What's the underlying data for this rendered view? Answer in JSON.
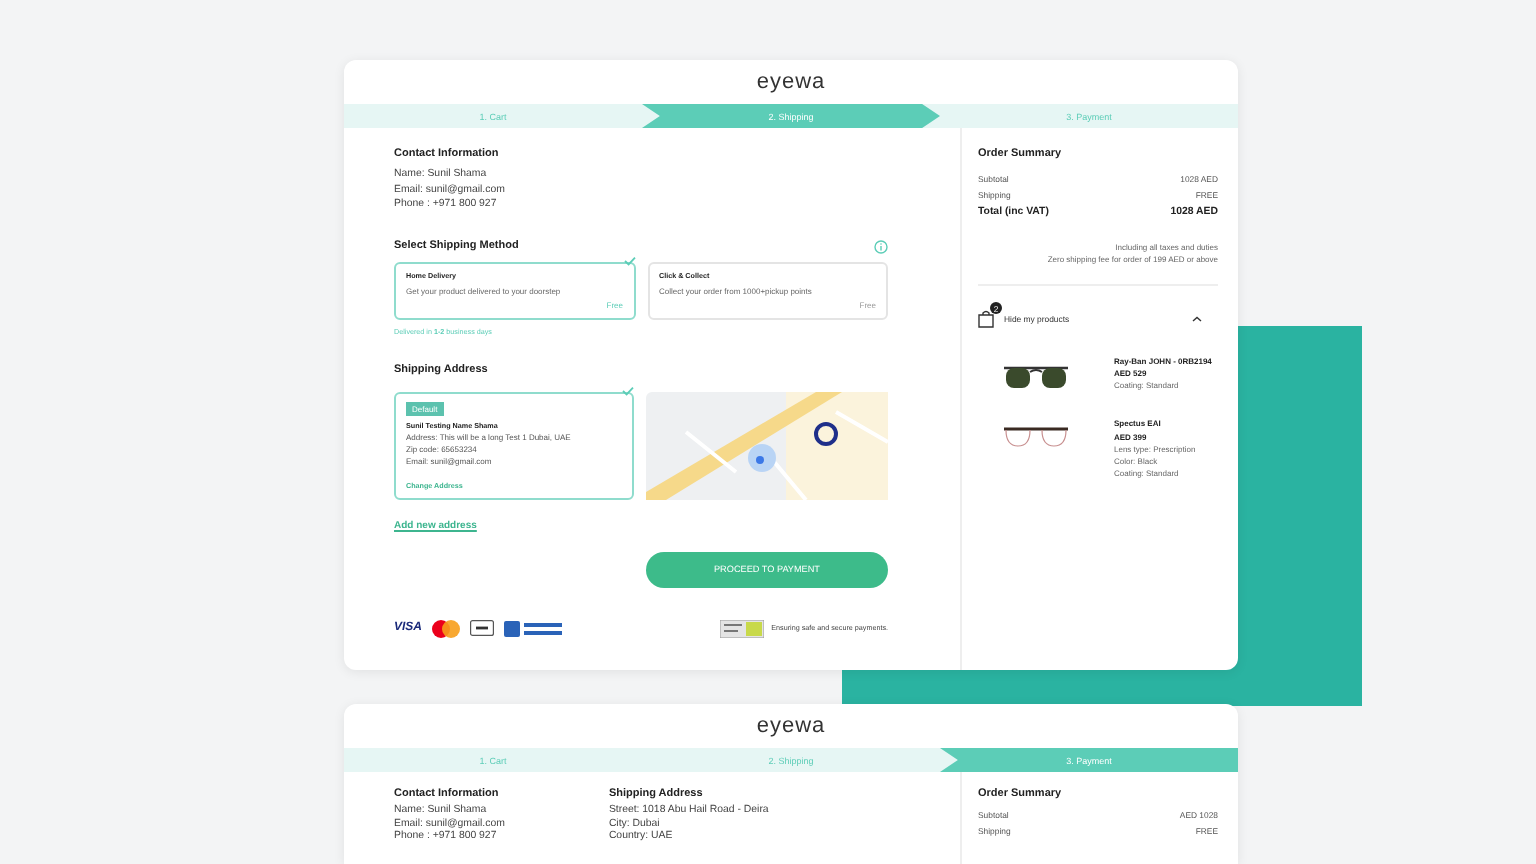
{
  "screens": [
    {
      "logo": "eyewa",
      "steps": [
        {
          "label": "1. Cart",
          "selected": false
        },
        {
          "label": "2. Shipping",
          "selected": true
        },
        {
          "label": "3. Payment",
          "selected": false
        }
      ],
      "contact": {
        "title": "Contact Information",
        "lines": [
          "Name: Sunil Shama",
          "Email: sunil@gmail.com",
          "Phone : +971 800 927"
        ]
      },
      "shipping_method": {
        "title": "Select Shipping Method",
        "options": [
          {
            "title": "Home Delivery",
            "description": "Get your product delivered to your doorstep",
            "price": "Free",
            "selected": true
          },
          {
            "title": "Click & Collect",
            "description": "Collect your order from 1000+pickup points",
            "price": "Free",
            "selected": false
          }
        ],
        "note": "Delivered in **1-2** business days"
      },
      "shipping_address": {
        "title": "Shipping Address",
        "addresses": [
          {
            "badge": "Default",
            "name": "Sunil Testing Name Shama",
            "lines": [
              "Address: This will be a long Test 1 Dubai, UAE",
              "Zip code: 65653234",
              "Email: sunil@gmail.com"
            ],
            "action": "Change Address",
            "selected": true
          }
        ],
        "add_link": "Add new address"
      },
      "proceed_button": "PROCEED TO PAYMENT",
      "payment_methods": [
        {
          "kind": "visa",
          "label": "VISA"
        },
        {
          "kind": "mastercard"
        },
        {
          "kind": "applepay"
        },
        {
          "kind": "cod"
        }
      ],
      "secure_text": "Ensuring safe and secure payments.",
      "summary": {
        "title": "Order Summary",
        "rows": [
          {
            "label": "Subtotal",
            "value": "1028 AED",
            "kind": "normal"
          },
          {
            "label": "Shipping",
            "value": "FREE",
            "kind": "normal"
          },
          {
            "label": "Total (inc VAT)",
            "value": "1028 AED",
            "kind": "total"
          }
        ],
        "notes": [
          "Including all taxes and duties",
          "Zero shipping fee for order of 199 AED or above"
        ],
        "toggle_label": "Hide my products",
        "cart_count": "2",
        "products": [
          {
            "kind": "sunglasses",
            "name": "Ray-Ban JOHN - 0RB2194",
            "price": "AED 529",
            "details": [
              "Coating: Standard"
            ]
          },
          {
            "kind": "eyeglasses",
            "name": "Spectus EAI",
            "price": "AED 399",
            "details": [
              "Lens type: Prescription",
              "Color: Black",
              "Coating: Standard"
            ]
          }
        ]
      }
    },
    {
      "logo": "eyewa",
      "steps": [
        {
          "label": "1. Cart",
          "selected": false
        },
        {
          "label": "2. Shipping",
          "selected": false
        },
        {
          "label": "3. Payment",
          "selected": true
        }
      ],
      "contact": {
        "title": "Contact Information",
        "lines": [
          "Name: Sunil Shama",
          "Email: sunil@gmail.com",
          "Phone : +971 800 927"
        ]
      },
      "address_summary": {
        "title": "Shipping Address",
        "lines": [
          "Street: 1018 Abu Hail Road - Deira",
          "City: Dubai",
          "Country: UAE"
        ]
      },
      "summary": {
        "title": "Order Summary",
        "rows": [
          {
            "label": "Subtotal",
            "value": "AED 1028",
            "kind": "normal"
          },
          {
            "label": "Shipping",
            "value": "FREE",
            "kind": "normal"
          }
        ]
      }
    }
  ]
}
